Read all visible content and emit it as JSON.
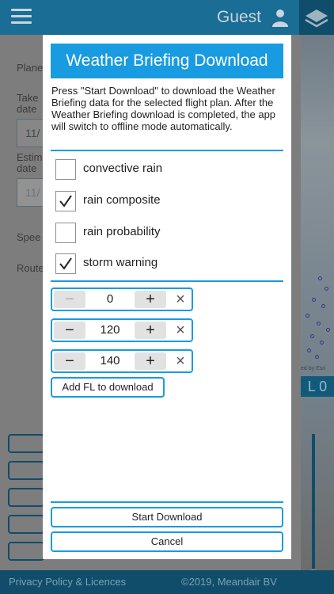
{
  "header": {
    "user_label": "Guest"
  },
  "background_form": {
    "labels": [
      "Plane",
      "Take",
      "date",
      "Estim",
      "date",
      "Spee",
      "Route"
    ],
    "fields": [
      "11/",
      "11/"
    ]
  },
  "map": {
    "fl_label": "L 0",
    "attribution": "ed by Esri"
  },
  "footer": {
    "privacy": "Privacy Policy & Licences",
    "copyright": "©2019, Meandair BV"
  },
  "modal": {
    "title": "Weather Briefing Download",
    "description": "Press \"Start Download\" to download the Weather Briefing data for the selected flight plan. After the Weather Briefing download is completed, the app will switch to offline mode automatically.",
    "options": [
      {
        "label": "convective rain",
        "checked": false
      },
      {
        "label": "rain composite",
        "checked": true
      },
      {
        "label": "rain probability",
        "checked": false
      },
      {
        "label": "storm warning",
        "checked": true
      }
    ],
    "flight_levels": [
      {
        "value": "0",
        "minus": "−",
        "plus": "+",
        "remove": "×"
      },
      {
        "value": "120",
        "minus": "−",
        "plus": "+",
        "remove": "×"
      },
      {
        "value": "140",
        "minus": "−",
        "plus": "+",
        "remove": "×"
      }
    ],
    "add_fl_label": "Add FL to download",
    "start_label": "Start Download",
    "cancel_label": "Cancel"
  },
  "colors": {
    "accent": "#189be0",
    "header": "#1a6d94",
    "footer": "#0f4d6b"
  }
}
